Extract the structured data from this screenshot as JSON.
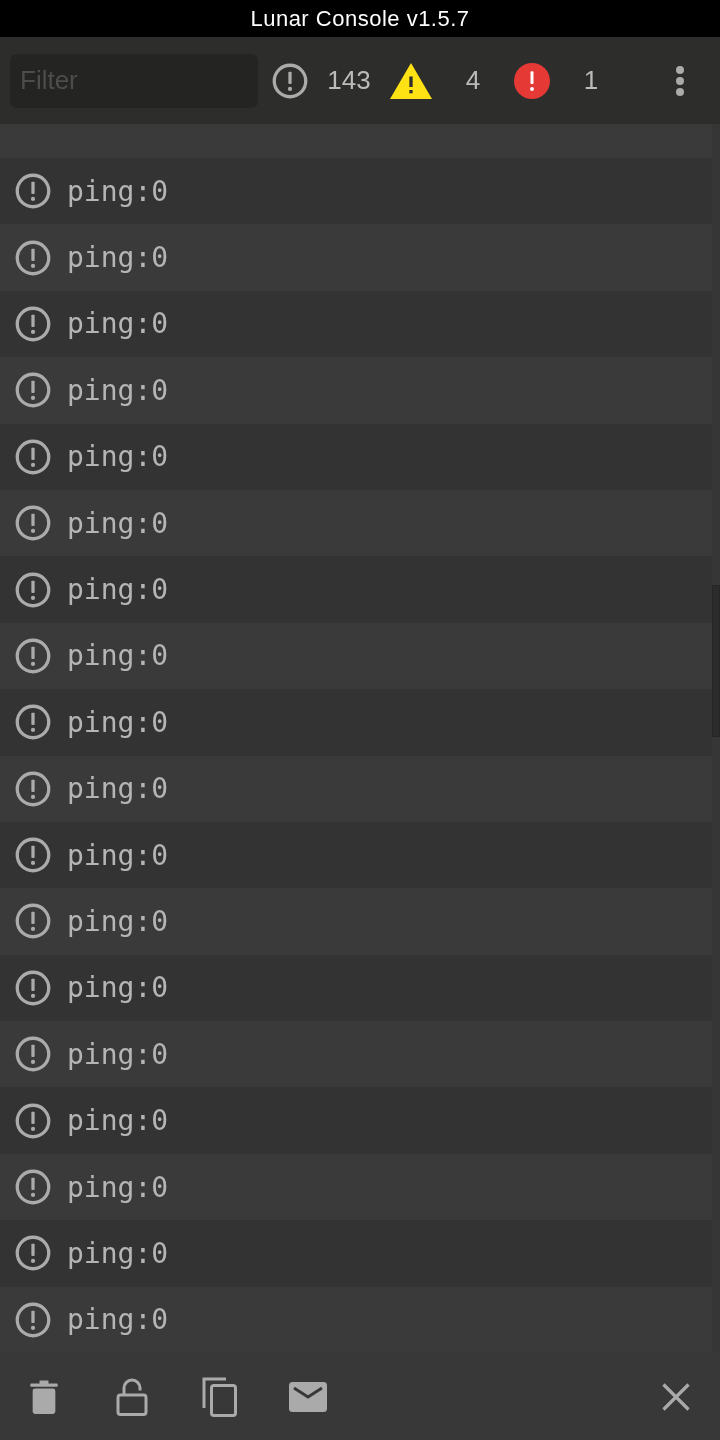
{
  "window": {
    "title": "Lunar Console v1.5.7"
  },
  "toolbar": {
    "filter": {
      "placeholder": "Filter"
    },
    "counters": [
      {
        "kind": "log",
        "count": "143"
      },
      {
        "kind": "warning",
        "count": "4"
      },
      {
        "kind": "error",
        "count": "1"
      }
    ]
  },
  "log_entries": [
    {
      "kind": "log",
      "message": "ping:0"
    },
    {
      "kind": "log",
      "message": "ping:0"
    },
    {
      "kind": "log",
      "message": "ping:0"
    },
    {
      "kind": "log",
      "message": "ping:0"
    },
    {
      "kind": "log",
      "message": "ping:0"
    },
    {
      "kind": "log",
      "message": "ping:0"
    },
    {
      "kind": "log",
      "message": "ping:0"
    },
    {
      "kind": "log",
      "message": "ping:0"
    },
    {
      "kind": "log",
      "message": "ping:0"
    },
    {
      "kind": "log",
      "message": "ping:0"
    },
    {
      "kind": "log",
      "message": "ping:0"
    },
    {
      "kind": "log",
      "message": "ping:0"
    },
    {
      "kind": "log",
      "message": "ping:0"
    },
    {
      "kind": "log",
      "message": "ping:0"
    },
    {
      "kind": "log",
      "message": "ping:0"
    },
    {
      "kind": "log",
      "message": "ping:0"
    },
    {
      "kind": "log",
      "message": "ping:0"
    },
    {
      "kind": "log",
      "message": "ping:0"
    }
  ]
}
